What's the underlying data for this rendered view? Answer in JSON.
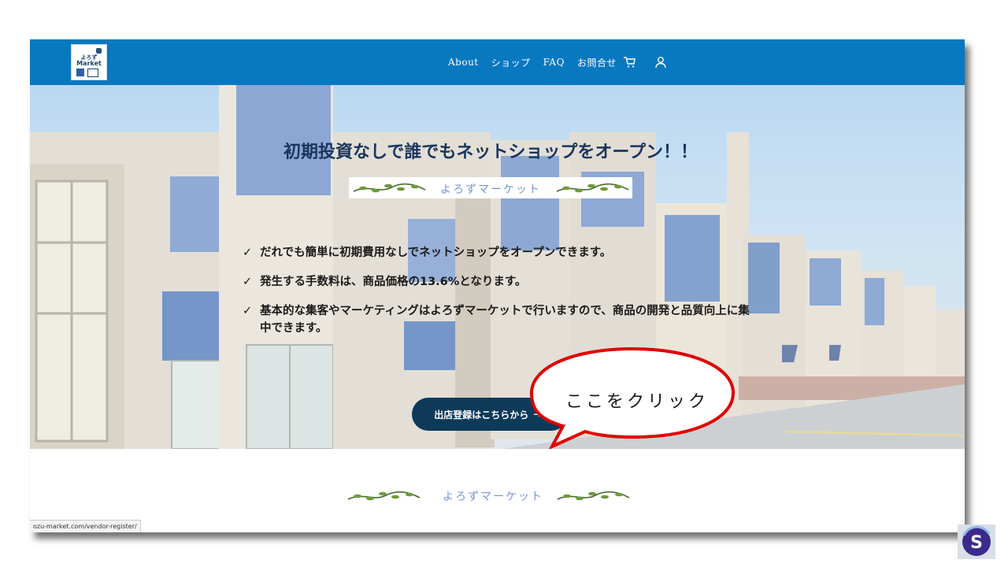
{
  "header": {
    "logo_line1": "よろず",
    "logo_line2": "Market",
    "nav": [
      "About",
      "ショップ",
      "FAQ",
      "お問合せ"
    ],
    "icons": [
      "cart-icon",
      "user-icon"
    ]
  },
  "hero": {
    "title": "初期投資なしで誰でもネットショップをオープン！！",
    "brand": "よろずマーケット",
    "bullets": [
      "だれでも簡単に初期費用なしでネットショップをオープンできます。",
      "発生する手数料は、商品価格の13.6%となります。",
      "基本的な集客やマーケティングはよろずマーケットで行いますので、商品の開発と品質向上に集中できます。"
    ],
    "check_mark": "✓",
    "cta_label": "出店登録はこちらから",
    "cta_arrow": "→]"
  },
  "callout": {
    "text": "ここをクリック"
  },
  "footer_brand": "よろずマーケット",
  "statusbar": {
    "url": "ozu-market.com/vendor-register/"
  },
  "badge": {
    "letter": "S"
  },
  "colors": {
    "navbar": "#0878c0",
    "cta": "#0e3a5a",
    "callout_border": "#e00000",
    "title": "#1a355c"
  }
}
